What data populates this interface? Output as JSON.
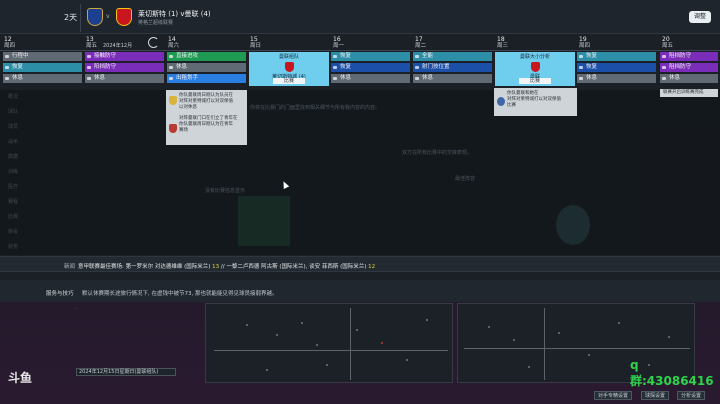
{
  "header": {
    "days_left": "2天",
    "match_title": "莱切斯特 (1) v曼联 (4)",
    "match_sub": "英格兰超级联赛",
    "vs": "v",
    "close_label": "调整"
  },
  "calendar": {
    "month": "2024年12月",
    "days": [
      {
        "num": "12",
        "dow": "周四"
      },
      {
        "num": "13",
        "dow": "周五"
      },
      {
        "num": "14",
        "dow": "周六"
      },
      {
        "num": "15",
        "dow": "周日"
      },
      {
        "num": "16",
        "dow": "周一"
      },
      {
        "num": "17",
        "dow": "周二"
      },
      {
        "num": "18",
        "dow": "周三"
      },
      {
        "num": "19",
        "dow": "周四"
      },
      {
        "num": "20",
        "dow": "周五"
      }
    ]
  },
  "columns": {
    "c12": [
      "行程中",
      "恢复",
      "休息"
    ],
    "c13": [
      "接触防守",
      "阳挡防守",
      "休息"
    ],
    "c14": [
      "直接进攻",
      "休息",
      "出租划手"
    ],
    "c16": [
      "恢复",
      "恢复",
      "休息"
    ],
    "c17": [
      "全能",
      "射门技位置",
      "休息"
    ],
    "c19": [
      "恢复",
      "恢复",
      "休息"
    ],
    "c20": [
      "阻挡防守",
      "阻挡防守",
      "休息"
    ]
  },
  "match_cards": {
    "card15": {
      "top": "曼联组队",
      "mid": "莱切斯特城 (4)",
      "tag": "比赛"
    },
    "card18": {
      "top": "曼联大小分析",
      "mid": "曼联",
      "tag": "比赛"
    }
  },
  "tooltips": {
    "t14a": [
      "你队曼联周日刚认为队员在",
      "对阵对莱特城打以对双保值",
      "以对休息"
    ],
    "t14b": [
      "对阵曼联门口在们立了青年在",
      "你队曼联周日刚认为在青年",
      "赛场"
    ],
    "t18": [
      "你队曼联和她在",
      "对阵对莱特城打以对双保值",
      "比赛"
    ],
    "t20": "联赛开启训练赛完成"
  },
  "faded": {
    "f1": "你将在比赛门的门面里找到相关细节与所有我内容的内容。",
    "f2": "双方在所有比赛中的交锋表现。",
    "f3": "最佳阵容",
    "f4": "没有比赛信息显示"
  },
  "sidebar_ghost": [
    "概况",
    "球队",
    "球员",
    "战术",
    "数据",
    "训练",
    "医疗",
    "赛程",
    "比赛",
    "转会",
    "财务"
  ],
  "news": {
    "label": "新闻",
    "text_a": "意甲联赛最佳赛场: 第一罗米尔 对达德维维 (国际米兰) ",
    "hl_a": "13",
    "text_b": " // 一黎二卢西德 阿古斯 (国际米兰), 谈安 菲西斯 (国际米兰) ",
    "hl_b": "12"
  },
  "advice": {
    "label": "服务与技巧",
    "text": "默认休赛期长途旅行情况下, 在虚钱中被节73, 那也就能能见得见球员接弱界越。"
  },
  "lower": {
    "date_value": "2024年12月15日星期日(曼联组队)",
    "btn_compare": "对手专精设置",
    "btn_find": "球探设置",
    "btn_analysis": "分析设置",
    "logo": "斗鱼",
    "watermark": "q群:43086416"
  }
}
